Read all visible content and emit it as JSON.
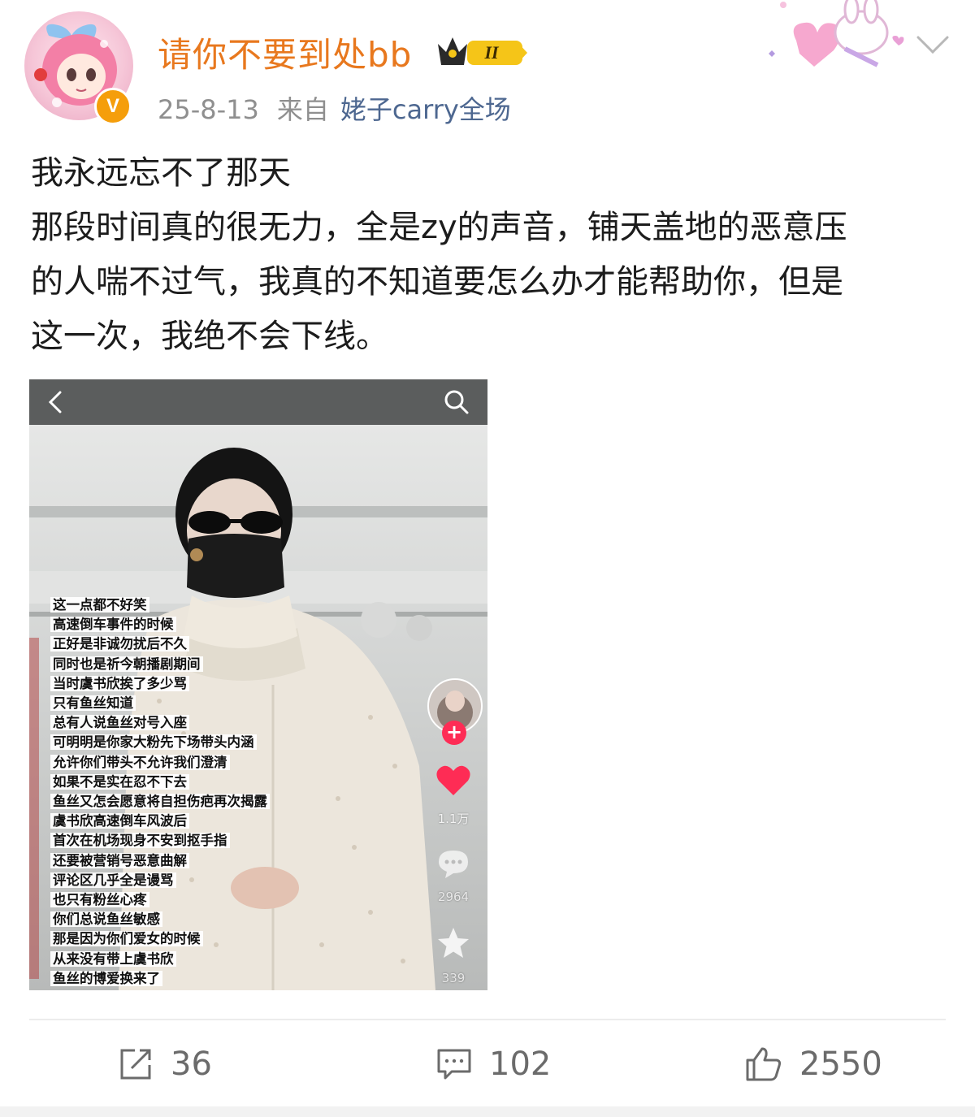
{
  "header": {
    "username": "请你不要到处bb",
    "level_badge": "II",
    "verified_badge": "V",
    "date": "25-8-13",
    "from_label": "来自",
    "source": "姥子carry全场"
  },
  "post": {
    "lines": [
      "我永远忘不了那天",
      "那段时间真的很无力，全是zy的声音，铺天盖地的恶意压",
      "的人喘不过气，我真的不知道要怎么办才能帮助你，但是",
      "这一次，我绝不会下线。"
    ]
  },
  "media": {
    "overlay_lines": [
      "这一点都不好笑",
      "高速倒车事件的时候",
      "正好是非诚勿扰后不久",
      "同时也是祈今朝播剧期间",
      "当时虞书欣挨了多少骂",
      "只有鱼丝知道",
      "总有人说鱼丝对号入座",
      "可明明是你家大粉先下场带头内涵",
      "允许你们带头不允许我们澄清",
      "如果不是实在忍不下去",
      "鱼丝又怎会愿意将自担伤疤再次揭露",
      "虞书欣高速倒车风波后",
      "首次在机场现身不安到抠手指",
      "还要被营销号恶意曲解",
      "评论区几乎全是谩骂",
      "也只有粉丝心疼",
      "你们总说鱼丝敏感",
      "那是因为你们爱女的时候",
      "从来没有带上虞书欣",
      "鱼丝的博爱换来了"
    ],
    "follow_plus": "+",
    "like_count": "1.1万",
    "comment_count": "2964",
    "fav_count": "339",
    "icons": [
      "back-arrow-icon",
      "search-icon",
      "heart-icon",
      "comment-bubble-icon",
      "star-icon"
    ]
  },
  "actions": {
    "repost_count": "36",
    "comment_count": "102",
    "like_count": "2550"
  },
  "colors": {
    "username": "#e8781e",
    "source_link": "#4d6790",
    "meta": "#8f8f8f",
    "verified": "#f59e0b",
    "heart": "#fe2c55"
  }
}
